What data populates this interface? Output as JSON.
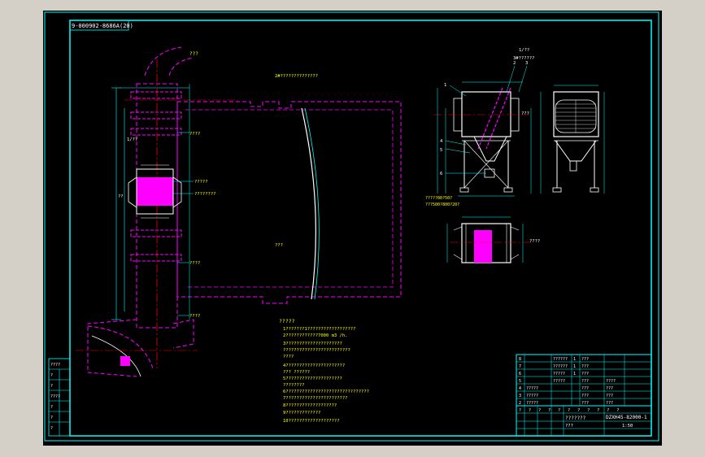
{
  "drawing_no": "9-000902-8686A(20)",
  "plan": {
    "left_duct_label": "???",
    "duct_note_1": "????",
    "duct_note_2": "????",
    "filter_label_1": "?????",
    "filter_label_2": "????????",
    "duct_note_3": "????",
    "elbow_label": "????",
    "dim_left_1": "1/??",
    "dim_left_2": "??",
    "top_label": "2#??????????????",
    "room_label": "???",
    "center_note": "?"
  },
  "tech_req": {
    "title": "?????",
    "lines": [
      "1???????1??????????????????",
      "2????????????7000 m3   /h.",
      "3?????????????????????",
      "  ?????????????????????????",
      "  ????",
      "4??????????????????????",
      "  ??? ??????",
      "5?????????????????????",
      "  ????????",
      "6???????????????????????????????",
      "7???????????????????????",
      "8???????????????????",
      "9?????????????",
      "10???????????????????"
    ]
  },
  "elevation": {
    "top_label_1": "1/??",
    "top_label_2": "3#??????",
    "callouts": [
      "1",
      "2",
      "3",
      "4",
      "5",
      "6"
    ],
    "side_dim": "???",
    "bottom_note_1": "?????00?50?",
    "bottom_note_2": "???500?800?20?",
    "plan_dim": "????"
  },
  "title_block": {
    "parts_rows": [
      {
        "no": "8",
        "name": "??????",
        "qty": "1",
        "note": "???"
      },
      {
        "no": "7",
        "name": "??????",
        "qty": "1",
        "note": "???"
      },
      {
        "no": "6",
        "name": "?????",
        "qty": "1",
        "note": "???"
      },
      {
        "no": "5",
        "name": "?????",
        "qty": "???",
        "note": "????"
      },
      {
        "no": "4",
        "name": "?????",
        "qty": "???",
        "note": "???"
      },
      {
        "no": "3",
        "name": "?????",
        "qty": "???",
        "note": "???"
      },
      {
        "no": "2",
        "name": "?????",
        "qty": "???",
        "note": "???"
      },
      {
        "no": "1",
        "name": "?????",
        "qty": "???",
        "note": "???"
      }
    ],
    "parts_header": [
      "?",
      "?",
      "?",
      "?",
      "?",
      "?",
      "?",
      "?",
      "?",
      "?",
      "?"
    ],
    "project_name": "???????",
    "project_sub": "???",
    "drawing_code": "DZXH45-82000-1",
    "scale": "1:50"
  },
  "left_strip": {
    "labels": [
      "????",
      "?",
      "?",
      "????",
      "?",
      "?",
      "?"
    ]
  },
  "colors": {
    "border": "#00ffff",
    "text_yellow": "#ffff00",
    "pipe_magenta": "#ff00ff",
    "white": "#ffffff",
    "dim_cyan": "#00ffff",
    "green": "#00ff00",
    "red": "#ff0000"
  }
}
